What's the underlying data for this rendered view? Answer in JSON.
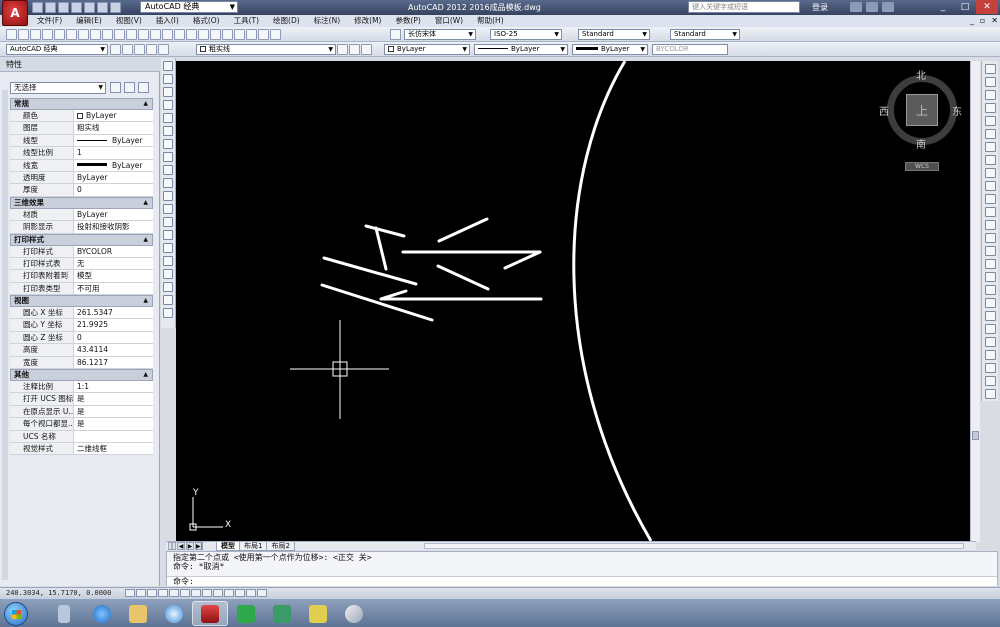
{
  "window": {
    "title": "AutoCAD 2012    2016成品模板.dwg",
    "workspace": "AutoCAD 经典",
    "help_search_placeholder": "键入关键字或短语",
    "login": "登录"
  },
  "menu": [
    "文件(F)",
    "编辑(E)",
    "视图(V)",
    "插入(I)",
    "格式(O)",
    "工具(T)",
    "绘图(D)",
    "标注(N)",
    "修改(M)",
    "参数(P)",
    "窗口(W)",
    "帮助(H)"
  ],
  "toolbar2": {
    "text_style_font": "长仿宋体",
    "dim_style": "ISO-25",
    "table_style": "Standard",
    "multileader_style": "Standard"
  },
  "toolbar3": {
    "workspace": "AutoCAD 经典",
    "layer": "粗实线",
    "color": "ByLayer",
    "linetype": "ByLayer",
    "lineweight": "ByLayer",
    "plotstyle": "BYCOLOR"
  },
  "properties": {
    "title": "特性",
    "selection": "无选择",
    "sections": [
      {
        "name": "常规",
        "rows": [
          {
            "k": "颜色",
            "v": "ByLayer"
          },
          {
            "k": "图层",
            "v": "粗实线"
          },
          {
            "k": "线型",
            "v": "ByLayer"
          },
          {
            "k": "线型比例",
            "v": "1"
          },
          {
            "k": "线宽",
            "v": "ByLayer"
          },
          {
            "k": "透明度",
            "v": "ByLayer"
          },
          {
            "k": "厚度",
            "v": "0"
          }
        ]
      },
      {
        "name": "三维效果",
        "rows": [
          {
            "k": "材质",
            "v": "ByLayer"
          },
          {
            "k": "阴影显示",
            "v": "投射和接收阴影"
          }
        ]
      },
      {
        "name": "打印样式",
        "rows": [
          {
            "k": "打印样式",
            "v": "BYCOLOR"
          },
          {
            "k": "打印样式表",
            "v": "无"
          },
          {
            "k": "打印表附着到",
            "v": "模型"
          },
          {
            "k": "打印表类型",
            "v": "不可用"
          }
        ]
      },
      {
        "name": "视图",
        "rows": [
          {
            "k": "圆心 X 坐标",
            "v": "261.5347"
          },
          {
            "k": "圆心 Y 坐标",
            "v": "21.9925"
          },
          {
            "k": "圆心 Z 坐标",
            "v": "0"
          },
          {
            "k": "高度",
            "v": "43.4114"
          },
          {
            "k": "宽度",
            "v": "86.1217"
          }
        ]
      },
      {
        "name": "其他",
        "rows": [
          {
            "k": "注释比例",
            "v": "1:1"
          },
          {
            "k": "打开 UCS 图标",
            "v": "是"
          },
          {
            "k": "在原点显示 U...",
            "v": "是"
          },
          {
            "k": "每个视口都显...",
            "v": "是"
          },
          {
            "k": "UCS 名称",
            "v": ""
          },
          {
            "k": "视觉样式",
            "v": "二维线框"
          }
        ]
      }
    ]
  },
  "viewcube": {
    "north": "北",
    "south": "南",
    "east": "东",
    "west": "西",
    "top": "上",
    "ucs": "WCS"
  },
  "ucs_icon": {
    "x": "X",
    "y": "Y"
  },
  "tabs": [
    "模型",
    "布局1",
    "布局2"
  ],
  "command": {
    "line1": "指定第二个点或 <使用第一个点作为位移>:  <正交 关>",
    "line2": "命令: *取消*",
    "prompt": "命令:"
  },
  "status": {
    "coords": "240.3034, 15.7170, 0.0000"
  },
  "colors": {
    "canvas": "#000000",
    "accent": "#c4403a"
  }
}
